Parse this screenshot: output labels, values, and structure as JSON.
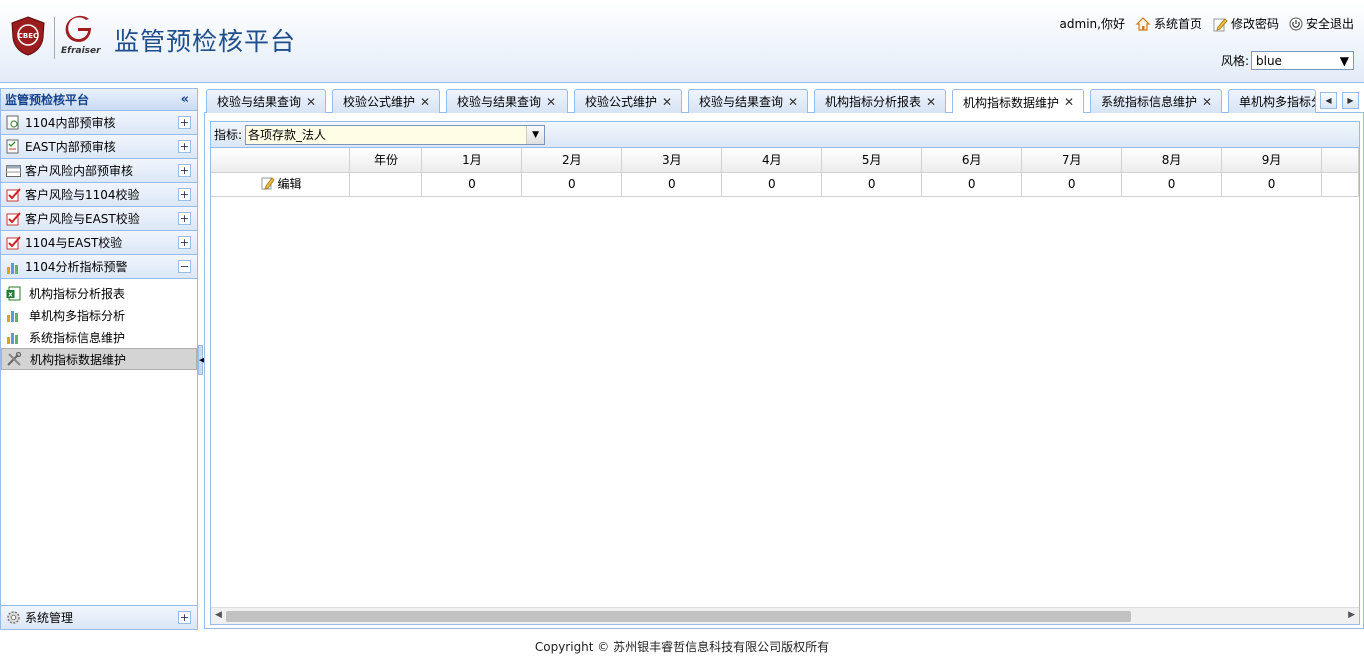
{
  "header": {
    "app_title": "监管预检核平台",
    "logo_badge": "CBEC",
    "logo_brand": "Efraiser",
    "greeting": "admin,你好",
    "home_label": "系统首页",
    "change_password_label": "修改密码",
    "logout_label": "安全退出",
    "style_label": "风格:",
    "style_value": "blue"
  },
  "sidebar": {
    "title": "监管预检核平台",
    "collapse_glyph": "«",
    "groups": [
      {
        "label": "1104内部预审核",
        "icon": "doc-gear-icon",
        "toggle": "+"
      },
      {
        "label": "EAST内部预审核",
        "icon": "checklist-icon",
        "toggle": "+"
      },
      {
        "label": "客户风险内部预审核",
        "icon": "table-icon",
        "toggle": "+"
      },
      {
        "label": "客户风险与1104校验",
        "icon": "check-badge-icon",
        "toggle": "+"
      },
      {
        "label": "客户风险与EAST校验",
        "icon": "check-badge-icon",
        "toggle": "+"
      },
      {
        "label": "1104与EAST校验",
        "icon": "check-badge-icon",
        "toggle": "+"
      },
      {
        "label": "1104分析指标预警",
        "icon": "bar-chart-icon",
        "toggle": "−"
      }
    ],
    "sub_items": [
      {
        "label": "机构指标分析报表",
        "icon": "excel-icon"
      },
      {
        "label": "单机构多指标分析",
        "icon": "bar-chart-icon"
      },
      {
        "label": "系统指标信息维护",
        "icon": "bar-chart-icon"
      },
      {
        "label": "机构指标数据维护",
        "icon": "tools-icon"
      }
    ],
    "system_group": {
      "label": "系统管理",
      "icon": "gear-icon",
      "toggle": "+"
    }
  },
  "tabs": [
    {
      "label": "校验与结果查询"
    },
    {
      "label": "校验公式维护"
    },
    {
      "label": "校验与结果查询"
    },
    {
      "label": "校验公式维护"
    },
    {
      "label": "校验与结果查询"
    },
    {
      "label": "机构指标分析报表"
    },
    {
      "label": "机构指标数据维护"
    },
    {
      "label": "系统指标信息维护"
    },
    {
      "label": "单机构多指标分析"
    }
  ],
  "tab_close_glyph": "✕",
  "active_tab_index": 6,
  "toolbar": {
    "indicator_label": "指标:",
    "indicator_value": "各项存款_法人"
  },
  "grid": {
    "columns": [
      "",
      "年份",
      "1月",
      "2月",
      "3月",
      "4月",
      "5月",
      "6月",
      "7月",
      "8月",
      "9月"
    ],
    "rows": [
      {
        "action": "编辑",
        "year": "",
        "values": [
          "0",
          "0",
          "0",
          "0",
          "0",
          "0",
          "0",
          "0",
          "0"
        ]
      }
    ]
  },
  "footer": {
    "copyright": "Copyright © 苏州银丰睿哲信息科技有限公司版权所有"
  },
  "colors": {
    "accent": "#99bbe8",
    "title": "#1f4e8c",
    "shield": "#9b1c1c"
  }
}
